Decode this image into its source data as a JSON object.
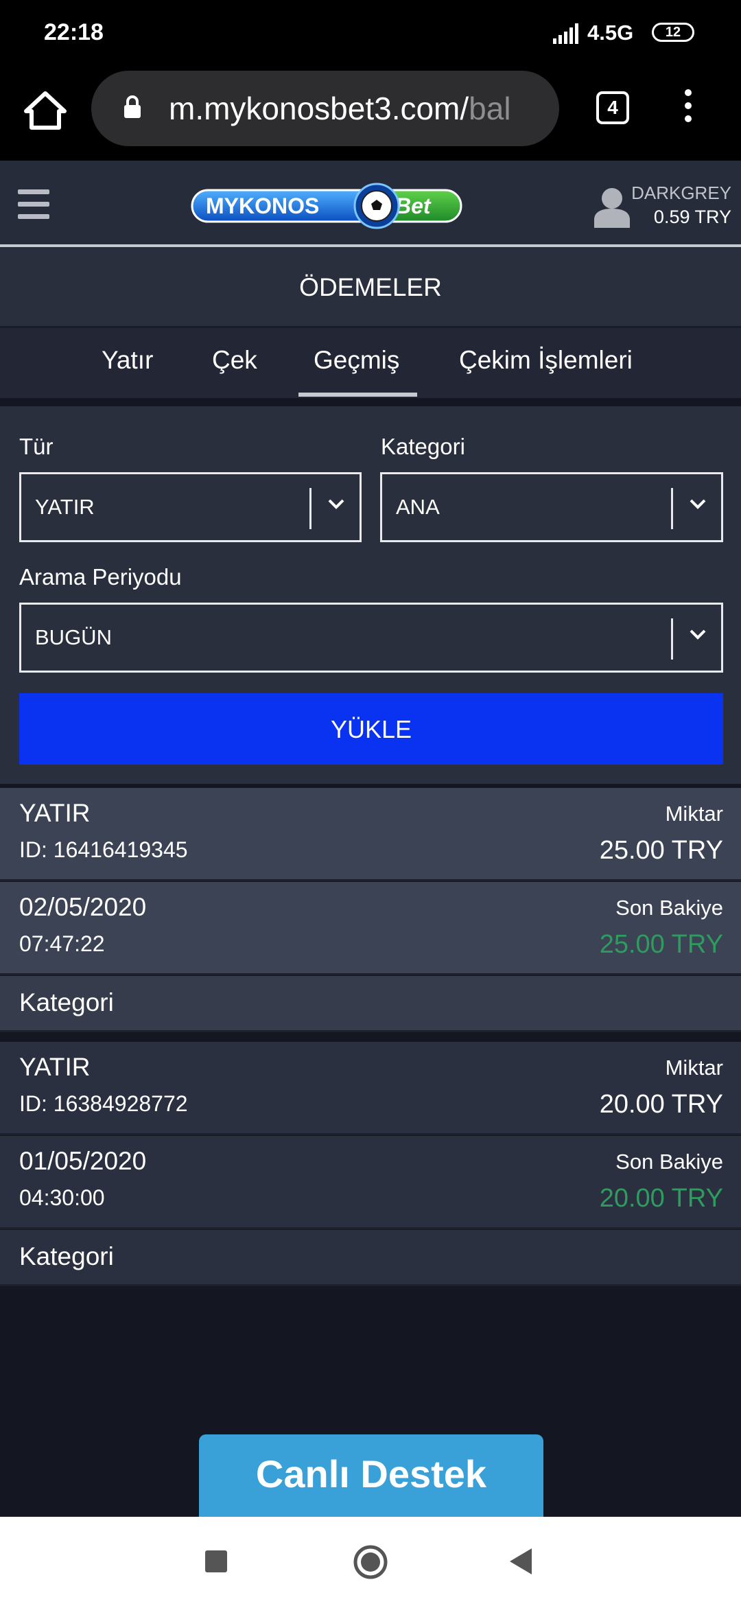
{
  "status_bar": {
    "time": "22:18",
    "network": "4.5G",
    "battery": "12"
  },
  "browser": {
    "url_main": "m.mykonosbet3.com/",
    "url_fade": "bal",
    "tab_count": "4"
  },
  "header": {
    "logo_left": "MYKONOS",
    "logo_right": "Bet",
    "username": "DARKGREY",
    "balance": "0.59 TRY"
  },
  "page_title": "ÖDEMELER",
  "tabs": [
    {
      "label": "Yatır"
    },
    {
      "label": "Çek"
    },
    {
      "label": "Geçmiş",
      "active": true
    },
    {
      "label": "Çekim İşlemleri"
    }
  ],
  "filters": {
    "type_label": "Tür",
    "type_value": "YATIR",
    "category_label": "Kategori",
    "category_value": "ANA",
    "period_label": "Arama Periyodu",
    "period_value": "BUGÜN",
    "load_button": "YÜKLE"
  },
  "transactions": [
    {
      "type": "YATIR",
      "id": "ID: 16416419345",
      "amount_label": "Miktar",
      "amount": "25.00 TRY",
      "date": "02/05/2020",
      "time": "07:47:22",
      "balance_label": "Son Bakiye",
      "balance": "25.00 TRY",
      "category_label": "Kategori"
    },
    {
      "type": "YATIR",
      "id": "ID: 16384928772",
      "amount_label": "Miktar",
      "amount": "20.00 TRY",
      "date": "01/05/2020",
      "time": "04:30:00",
      "balance_label": "Son Bakiye",
      "balance": "20.00 TRY",
      "category_label": "Kategori"
    }
  ],
  "support_button": "Canlı Destek",
  "colors": {
    "background": "#141722",
    "primary_button": "#0a32f1",
    "positive_balance": "#2e9b5f",
    "support": "#3aa0d8"
  }
}
